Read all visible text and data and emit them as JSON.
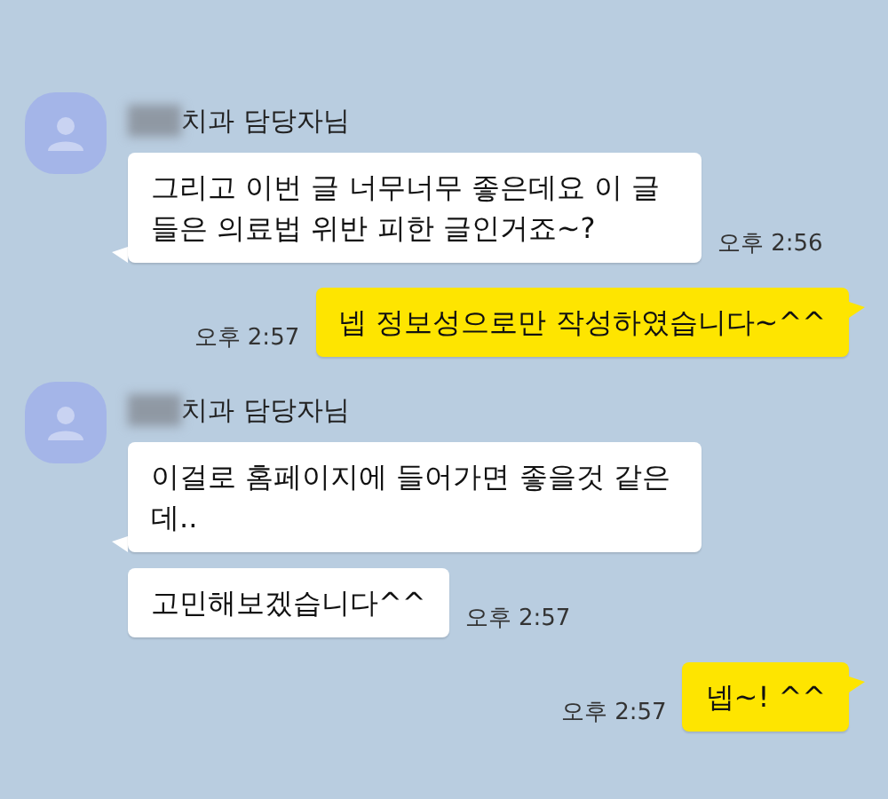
{
  "messages": [
    {
      "kind": "received",
      "sender": "치과 담당자님",
      "bubbles": [
        {
          "text": "그리고 이번 글 너무너무 좋은데요 이 글들은 의료법 위반 피한 글인거죠~?",
          "time": "오후 2:56"
        }
      ]
    },
    {
      "kind": "sent",
      "text": "넵 정보성으로만 작성하였습니다~^^",
      "time": "오후 2:57"
    },
    {
      "kind": "received",
      "sender": "치과 담당자님",
      "bubbles": [
        {
          "text": "이걸로 홈페이지에 들어가면 좋을것 같은데.."
        },
        {
          "text": "고민해보겠습니다^^",
          "time": "오후 2:57"
        }
      ]
    },
    {
      "kind": "sent",
      "text": "넵~! ^^",
      "time": "오후 2:57"
    }
  ]
}
